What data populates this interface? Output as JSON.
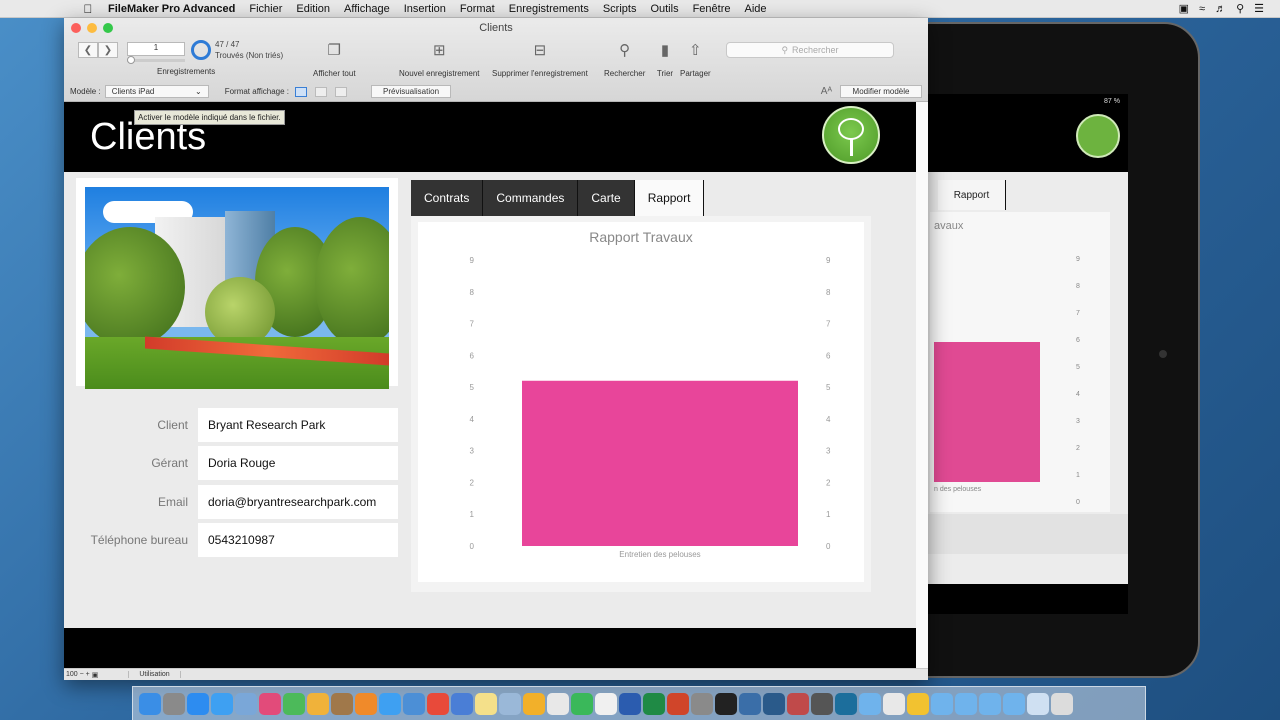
{
  "menubar": {
    "app": "FileMaker Pro Advanced",
    "items": [
      "Fichier",
      "Edition",
      "Affichage",
      "Insertion",
      "Format",
      "Enregistrements",
      "Scripts",
      "Outils",
      "Fenêtre",
      "Aide"
    ]
  },
  "window": {
    "title": "Clients"
  },
  "toolbar": {
    "record_number": "1",
    "found_count": "47 / 47",
    "found_status": "Trouvés (Non triés)",
    "records_label": "Enregistrements",
    "show_all": "Afficher tout",
    "new_record": "Nouvel enregistrement",
    "delete_record": "Supprimer l'enregistrement",
    "find": "Rechercher",
    "sort": "Trier",
    "share": "Partager",
    "search_placeholder": "Rechercher"
  },
  "layoutbar": {
    "layout_label": "Modèle :",
    "layout_value": "Clients iPad",
    "view_label": "Format affichage :",
    "preview": "Prévisualisation",
    "modify_layout": "Modifier modèle"
  },
  "header": {
    "title": "Clients",
    "tooltip": "Activer le modèle indiqué dans le fichier."
  },
  "fields": [
    {
      "label": "Client",
      "value": "Bryant Research Park"
    },
    {
      "label": "Gérant",
      "value": "Doria Rouge"
    },
    {
      "label": "Email",
      "value": "doria@bryantresearchpark.com"
    },
    {
      "label": "Téléphone bureau",
      "value": "0543210987"
    }
  ],
  "tabs": [
    "Contrats",
    "Commandes",
    "Carte",
    "Rapport"
  ],
  "active_tab": "Rapport",
  "chart_data": {
    "type": "bar",
    "title": "Rapport Travaux",
    "categories": [
      "Entretien des pelouses"
    ],
    "values": [
      5.2
    ],
    "ylim": [
      0,
      9
    ],
    "yticks": [
      "0",
      "1",
      "2",
      "3",
      "4",
      "5",
      "6",
      "7",
      "8",
      "9"
    ],
    "color": "#e8459a",
    "grid": false
  },
  "statusbar": {
    "zoom": "100",
    "mode": "Utilisation"
  },
  "ipad": {
    "battery": "87 %",
    "tab": "Rapport",
    "title_partial": "avaux",
    "axis_partial": "n des pelouses"
  },
  "colors": {
    "accent_pink": "#e8459a",
    "logo_green": "#6db33f",
    "header_black": "#000000"
  }
}
